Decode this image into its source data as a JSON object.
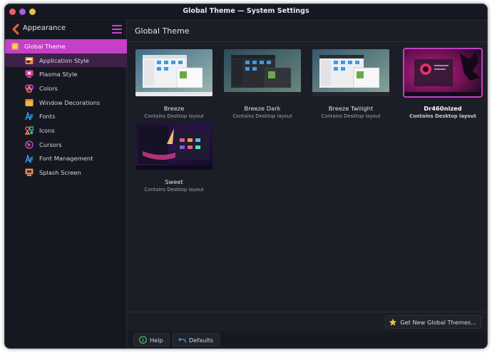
{
  "window": {
    "title": "Global Theme — System Settings"
  },
  "sidebar": {
    "header": "Appearance",
    "items": [
      {
        "label": "Global Theme",
        "icon": "global-theme-icon"
      },
      {
        "label": "Application Style",
        "icon": "application-style-icon"
      },
      {
        "label": "Plasma Style",
        "icon": "plasma-style-icon"
      },
      {
        "label": "Colors",
        "icon": "colors-icon"
      },
      {
        "label": "Window Decorations",
        "icon": "window-decorations-icon"
      },
      {
        "label": "Fonts",
        "icon": "fonts-icon"
      },
      {
        "label": "Icons",
        "icon": "icons-icon"
      },
      {
        "label": "Cursors",
        "icon": "cursors-icon"
      },
      {
        "label": "Font Management",
        "icon": "font-management-icon"
      },
      {
        "label": "Splash Screen",
        "icon": "splash-screen-icon"
      }
    ]
  },
  "main": {
    "title": "Global Theme",
    "themes": [
      {
        "name": "Breeze",
        "subtitle": "Contains Desktop layout"
      },
      {
        "name": "Breeze Dark",
        "subtitle": "Contains Desktop layout"
      },
      {
        "name": "Breeze Twilight",
        "subtitle": "Contains Desktop layout"
      },
      {
        "name": "Dr460nized",
        "subtitle": "Contains Desktop layout",
        "selected": true
      },
      {
        "name": "Sweet",
        "subtitle": "Contains Desktop layout"
      }
    ],
    "get_new_label": "Get New Global Themes...",
    "help_label": "Help",
    "defaults_label": "Defaults"
  },
  "colors": {
    "accent": "#c53fc7",
    "background": "#1b1d27",
    "sidebar": "#161821"
  }
}
